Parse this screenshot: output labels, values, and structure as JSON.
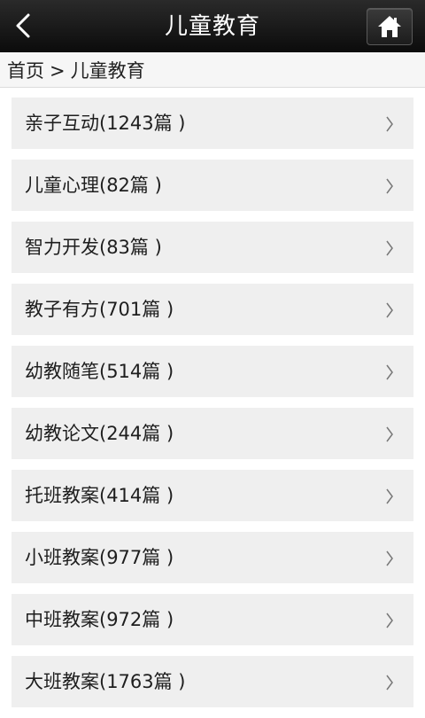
{
  "header": {
    "title": "儿童教育",
    "back_icon": "chevron-left-icon",
    "home_icon": "home-icon"
  },
  "breadcrumb": {
    "home": "首页",
    "separator": ">",
    "current": "儿童教育"
  },
  "categories": [
    {
      "label": "亲子互动(1243篇 )"
    },
    {
      "label": "儿童心理(82篇 )"
    },
    {
      "label": "智力开发(83篇 )"
    },
    {
      "label": "教子有方(701篇 )"
    },
    {
      "label": "幼教随笔(514篇 )"
    },
    {
      "label": "幼教论文(244篇 )"
    },
    {
      "label": "托班教案(414篇 )"
    },
    {
      "label": "小班教案(977篇 )"
    },
    {
      "label": "中班教案(972篇 )"
    },
    {
      "label": "大班教案(1763篇 )"
    }
  ],
  "colors": {
    "header_bg": "#111111",
    "item_bg": "#efefef",
    "chevron": "#777777"
  }
}
